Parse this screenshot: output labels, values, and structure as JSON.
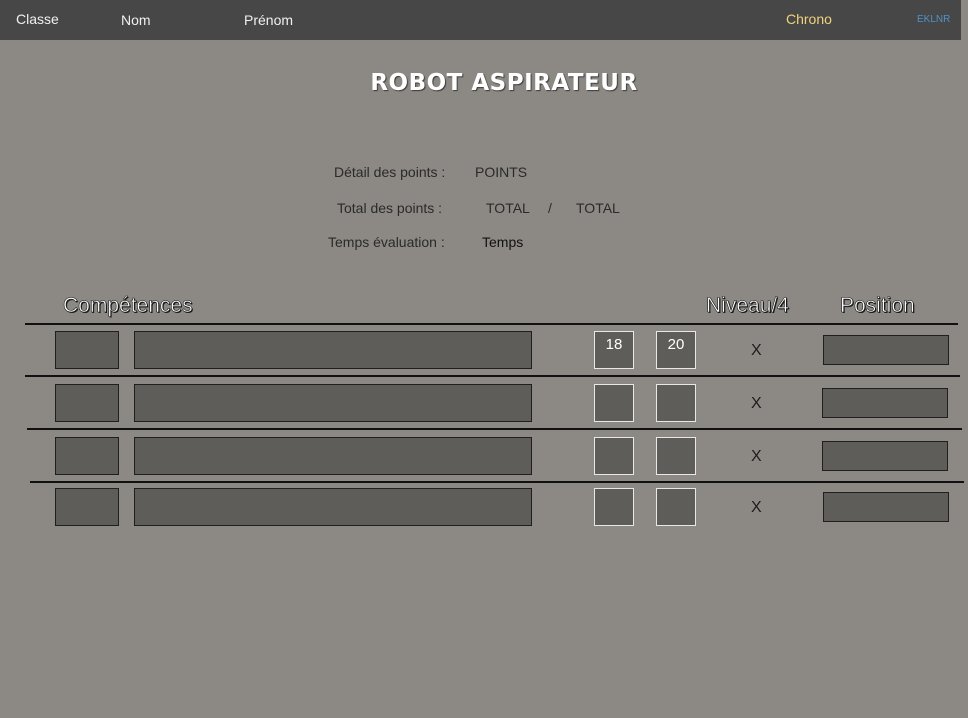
{
  "topbar": {
    "classe": "Classe",
    "nom": "Nom",
    "prenom": "Prénom",
    "chrono": "Chrono",
    "code": "EKLNR"
  },
  "title": "ROBOT ASPIRATEUR",
  "details": {
    "detail_label": "Détail des points :",
    "detail_value": "POINTS",
    "total_label": "Total des points :",
    "total_value": "TOTAL",
    "total_sep": "/",
    "total_max": "TOTAL",
    "temps_label": "Temps évaluation :",
    "temps_value": "Temps"
  },
  "headers": {
    "competences": "Compétences",
    "niveau": "Niveau/4",
    "position": "Position"
  },
  "rows": [
    {
      "score1": "18",
      "score2": "20",
      "mark": "X"
    },
    {
      "score1": "",
      "score2": "",
      "mark": "X"
    },
    {
      "score1": "",
      "score2": "",
      "mark": "X"
    },
    {
      "score1": "",
      "score2": "",
      "mark": "X"
    }
  ]
}
